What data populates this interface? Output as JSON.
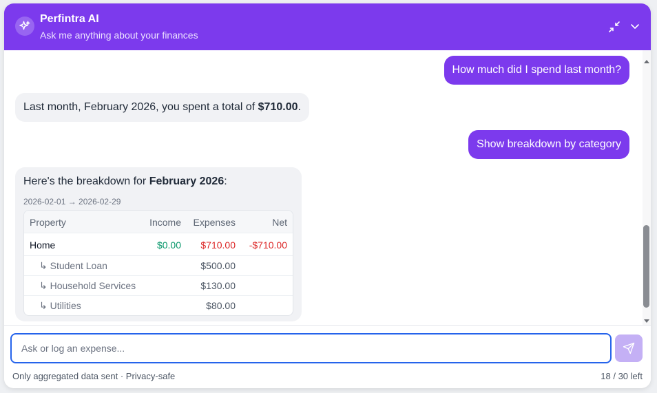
{
  "header": {
    "title": "Perfintra AI",
    "subtitle": "Ask me anything about your finances",
    "brand_color": "#7c3aed",
    "icons": [
      "sparkle-icon",
      "minimize-icon",
      "chevron-down-icon"
    ]
  },
  "messages": [
    {
      "role": "user",
      "text": "How much did I spend last month?"
    },
    {
      "role": "assistant",
      "prefix": "Last month, February 2026, you spent a total of ",
      "amount": "$710.00",
      "suffix": "."
    },
    {
      "role": "user",
      "text": "Show breakdown by category"
    },
    {
      "role": "assistant",
      "intro_prefix": "Here's the breakdown for ",
      "intro_bold": "February 2026",
      "intro_suffix": ":",
      "range": "2026-02-01 → 2026-02-29",
      "table": {
        "columns": [
          "Property",
          "Income",
          "Expenses",
          "Net"
        ],
        "main_row": {
          "property": "Home",
          "income": "$0.00",
          "expenses": "$710.00",
          "net": "-$710.00"
        },
        "sub_rows": [
          {
            "label": "↳ Student Loan",
            "expenses": "$500.00"
          },
          {
            "label": "↳ Household Services",
            "expenses": "$130.00"
          },
          {
            "label": "↳ Utilities",
            "expenses": "$80.00"
          }
        ]
      }
    }
  ],
  "composer": {
    "placeholder": "Ask or log an expense...",
    "value": "",
    "privacy_note": "Only aggregated data sent · Privacy-safe",
    "counter": "18 / 30 left"
  }
}
